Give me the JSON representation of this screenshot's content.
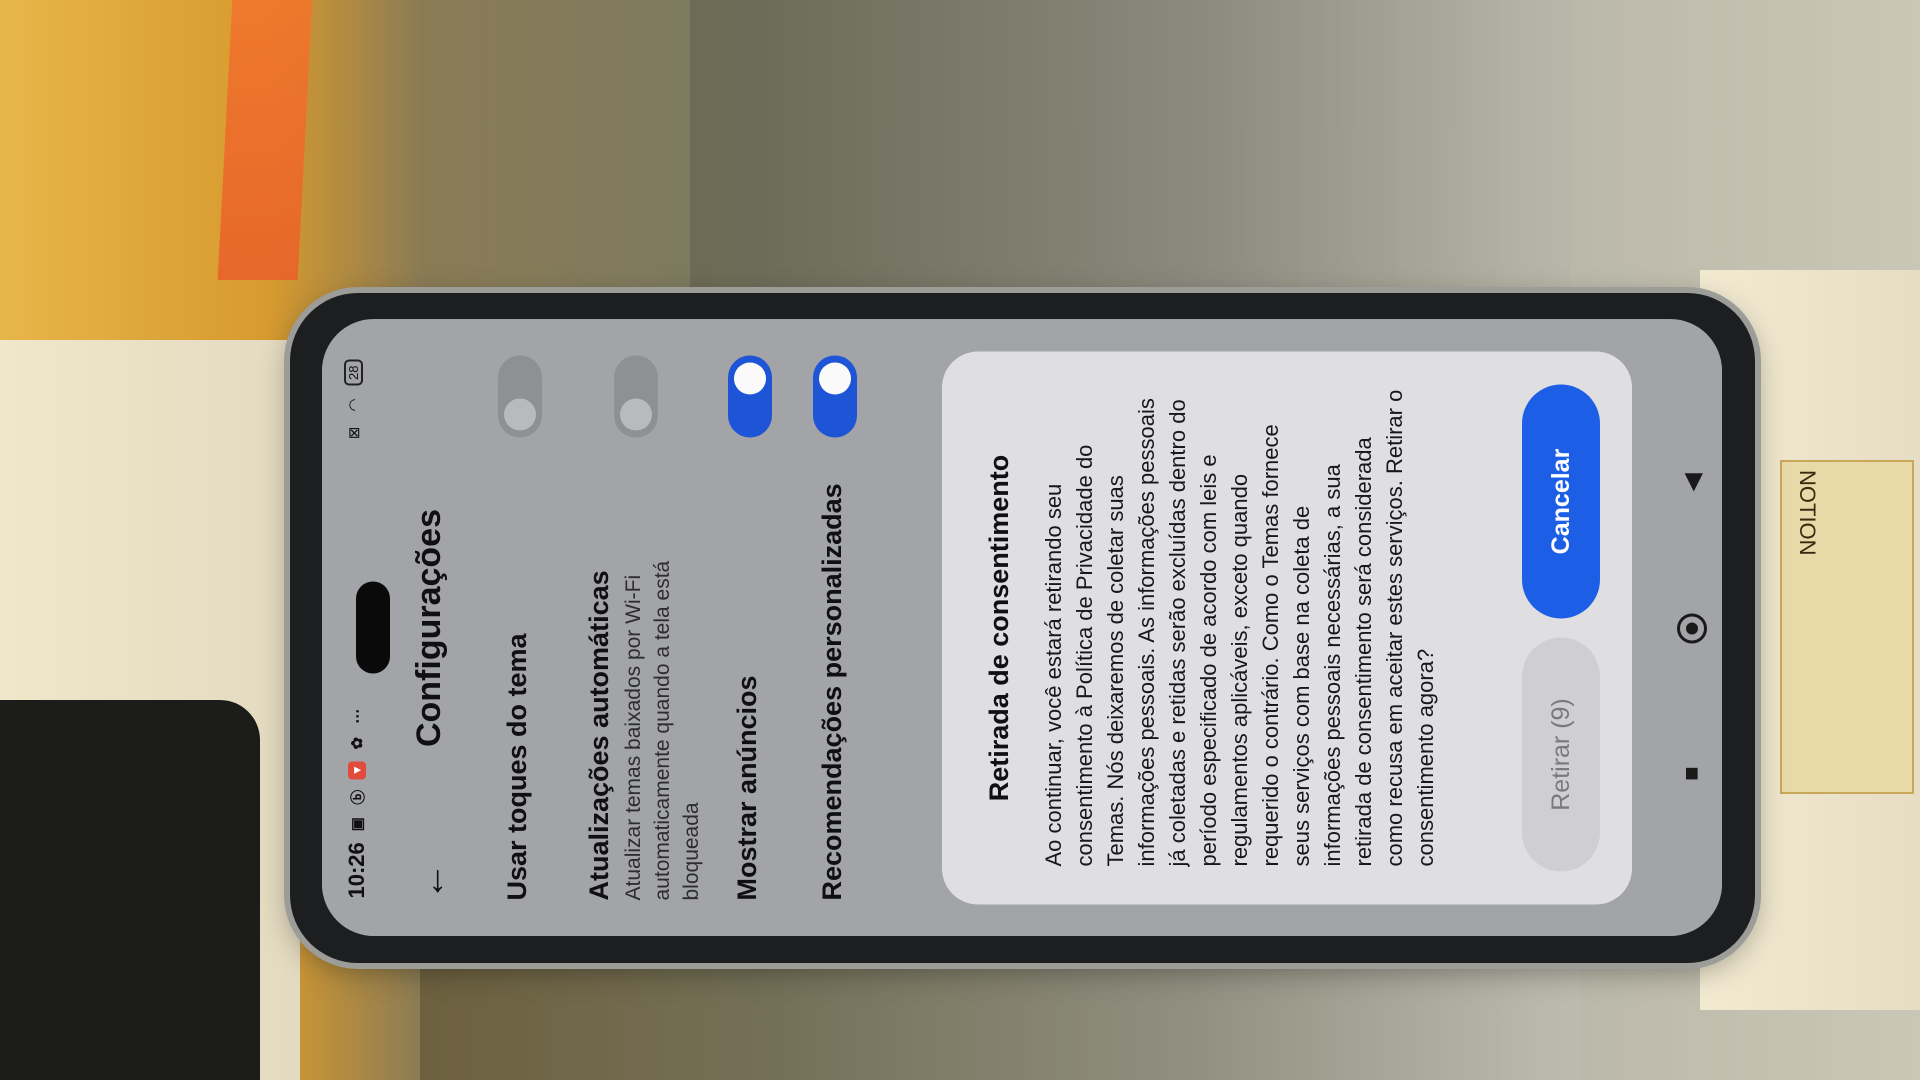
{
  "status_bar": {
    "time": "10:26",
    "battery": "28",
    "icons": [
      "nfc-icon",
      "cast-icon",
      "notification-app-icon",
      "settings-gear-icon",
      "more-dots-icon",
      "sim-icon",
      "wifi-icon",
      "battery-icon"
    ]
  },
  "header": {
    "back_icon": "arrow-left-icon",
    "title": "Configurações"
  },
  "settings": {
    "item1": {
      "title": "Usar toques do tema",
      "enabled": false
    },
    "item2": {
      "title": "Atualizações automáticas",
      "description": "Atualizar temas baixados por Wi-Fi automaticamente quando a tela está bloqueada",
      "enabled": false
    },
    "item3": {
      "title": "Mostrar anúncios",
      "enabled": true
    },
    "item4": {
      "title": "Recomendações personalizadas",
      "enabled": true
    }
  },
  "dialog": {
    "title": "Retirada de consentimento",
    "body": "Ao continuar, você estará retirando seu consentimento à Política de Privacidade do Temas. Nós deixaremos de coletar suas informações pessoais. As informações pessoais já coletadas e retidas serão excluídas dentro do período especificado de acordo com leis e regulamentos aplicáveis, exceto quando requerido o contrário. Como o Temas fornece seus serviços com base na coleta de informações pessoais necessárias, a sua retirada de consentimento será considerada como recusa em aceitar estes serviços. Retirar o consentimento agora?",
    "withdraw_button": "Retirar (9)",
    "cancel_button": "Cancelar"
  },
  "nav_bar": {
    "recents_icon": "square-recents-icon",
    "home_icon": "circle-home-icon",
    "back_icon": "triangle-back-icon"
  },
  "colors": {
    "accent": "#1d5ee6",
    "toggle_on": "#1d55d6",
    "toggle_off": "#8f9094",
    "dialog_bg": "#dfdfe2"
  },
  "scene": {
    "label_text": "NOTION"
  }
}
